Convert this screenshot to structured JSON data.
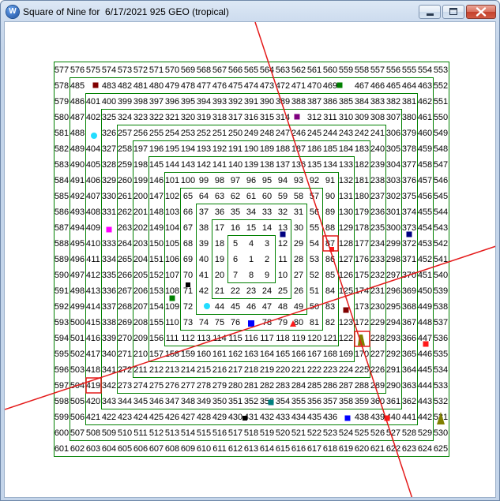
{
  "window": {
    "title": "Square of Nine for  6/17/2021 925 GEO (tropical)",
    "icon_letter": "W",
    "icons": {
      "app": "w-logo-icon",
      "minimize": "minimize-icon",
      "maximize": "maximize-icon",
      "close": "close-icon"
    }
  },
  "colors": {
    "ring_lines": "#008000",
    "angle_line": "#e41a1a",
    "highlight_box": "#e41a1a",
    "marker_maroon": "#800000",
    "marker_green": "#008000",
    "marker_purple": "#800080",
    "marker_cyan": "#22ddff",
    "marker_magenta": "#ff00ff",
    "marker_navy": "#000080",
    "marker_red": "#ff1a1a",
    "marker_black": "#000000",
    "marker_blue": "#0000ff",
    "marker_olive": "#808000",
    "marker_teal": "#008080"
  },
  "square_of_nine": {
    "grid": [
      [
        577,
        576,
        575,
        574,
        573,
        572,
        571,
        570,
        569,
        568,
        567,
        566,
        565,
        564,
        563,
        562,
        561,
        560,
        559,
        558,
        557,
        556,
        555,
        554,
        553
      ],
      [
        578,
        485,
        null,
        483,
        482,
        481,
        480,
        479,
        478,
        477,
        476,
        475,
        474,
        473,
        472,
        471,
        470,
        469,
        null,
        467,
        466,
        465,
        464,
        463,
        552
      ],
      [
        579,
        486,
        401,
        400,
        399,
        398,
        397,
        396,
        395,
        394,
        393,
        392,
        391,
        390,
        389,
        388,
        387,
        386,
        385,
        384,
        383,
        382,
        381,
        462,
        551
      ],
      [
        580,
        487,
        402,
        325,
        324,
        323,
        322,
        321,
        320,
        319,
        318,
        317,
        316,
        315,
        314,
        null,
        312,
        311,
        310,
        309,
        308,
        307,
        380,
        461,
        550
      ],
      [
        581,
        488,
        null,
        326,
        257,
        256,
        255,
        254,
        253,
        252,
        251,
        250,
        249,
        248,
        247,
        246,
        245,
        244,
        243,
        242,
        241,
        306,
        379,
        460,
        549
      ],
      [
        582,
        489,
        404,
        327,
        258,
        197,
        196,
        195,
        194,
        193,
        192,
        191,
        190,
        189,
        188,
        187,
        186,
        185,
        184,
        183,
        240,
        305,
        378,
        459,
        548
      ],
      [
        583,
        490,
        405,
        328,
        259,
        198,
        145,
        144,
        143,
        142,
        141,
        140,
        139,
        138,
        137,
        136,
        135,
        134,
        133,
        182,
        239,
        304,
        377,
        458,
        547
      ],
      [
        584,
        491,
        406,
        329,
        260,
        199,
        146,
        101,
        100,
        99,
        98,
        97,
        96,
        95,
        94,
        93,
        92,
        91,
        132,
        181,
        238,
        303,
        376,
        457,
        546
      ],
      [
        585,
        492,
        407,
        330,
        261,
        200,
        147,
        102,
        65,
        64,
        63,
        62,
        61,
        60,
        59,
        58,
        57,
        90,
        131,
        180,
        237,
        302,
        375,
        456,
        545
      ],
      [
        586,
        493,
        408,
        331,
        262,
        201,
        148,
        103,
        66,
        37,
        36,
        35,
        34,
        33,
        32,
        31,
        56,
        89,
        130,
        179,
        236,
        301,
        374,
        455,
        544
      ],
      [
        587,
        494,
        409,
        null,
        263,
        202,
        149,
        104,
        67,
        38,
        17,
        16,
        15,
        14,
        13,
        30,
        55,
        88,
        129,
        178,
        235,
        300,
        373,
        454,
        543
      ],
      [
        588,
        495,
        410,
        333,
        264,
        203,
        150,
        105,
        68,
        39,
        18,
        5,
        4,
        3,
        12,
        29,
        54,
        87,
        128,
        177,
        234,
        299,
        372,
        453,
        542
      ],
      [
        589,
        496,
        411,
        334,
        265,
        204,
        151,
        106,
        69,
        40,
        19,
        6,
        1,
        2,
        11,
        28,
        53,
        86,
        127,
        176,
        233,
        298,
        371,
        452,
        541
      ],
      [
        590,
        497,
        412,
        335,
        266,
        205,
        152,
        107,
        70,
        41,
        20,
        7,
        8,
        9,
        10,
        27,
        52,
        85,
        126,
        175,
        232,
        297,
        370,
        451,
        540
      ],
      [
        591,
        498,
        413,
        336,
        267,
        206,
        153,
        108,
        71,
        42,
        21,
        22,
        23,
        24,
        25,
        26,
        51,
        84,
        125,
        174,
        231,
        296,
        369,
        450,
        539
      ],
      [
        592,
        499,
        414,
        337,
        268,
        207,
        154,
        109,
        72,
        null,
        44,
        45,
        46,
        47,
        48,
        49,
        50,
        83,
        null,
        173,
        230,
        295,
        368,
        449,
        538
      ],
      [
        593,
        500,
        415,
        338,
        269,
        208,
        155,
        110,
        73,
        74,
        75,
        76,
        null,
        78,
        79,
        80,
        81,
        82,
        123,
        172,
        229,
        294,
        367,
        448,
        537
      ],
      [
        594,
        501,
        416,
        339,
        270,
        209,
        156,
        111,
        112,
        113,
        114,
        115,
        116,
        117,
        118,
        119,
        120,
        121,
        122,
        null,
        228,
        293,
        366,
        447,
        536
      ],
      [
        595,
        502,
        417,
        340,
        271,
        210,
        157,
        158,
        159,
        160,
        161,
        162,
        163,
        164,
        165,
        166,
        167,
        168,
        169,
        170,
        227,
        292,
        365,
        446,
        535
      ],
      [
        596,
        503,
        418,
        341,
        272,
        211,
        212,
        213,
        214,
        215,
        216,
        217,
        218,
        219,
        220,
        221,
        222,
        223,
        224,
        225,
        226,
        291,
        364,
        445,
        534
      ],
      [
        597,
        504,
        419,
        342,
        273,
        274,
        275,
        276,
        277,
        278,
        279,
        280,
        281,
        282,
        283,
        284,
        285,
        286,
        287,
        288,
        289,
        290,
        363,
        444,
        533
      ],
      [
        598,
        505,
        420,
        343,
        344,
        345,
        346,
        347,
        348,
        349,
        350,
        351,
        352,
        353,
        354,
        355,
        356,
        357,
        358,
        359,
        360,
        361,
        362,
        443,
        532
      ],
      [
        599,
        506,
        421,
        422,
        423,
        424,
        425,
        426,
        427,
        428,
        429,
        430,
        431,
        432,
        433,
        434,
        435,
        436,
        null,
        438,
        439,
        440,
        441,
        442,
        531
      ],
      [
        600,
        507,
        508,
        509,
        510,
        511,
        512,
        513,
        514,
        515,
        516,
        517,
        518,
        519,
        520,
        521,
        522,
        523,
        524,
        525,
        526,
        527,
        528,
        529,
        530
      ],
      [
        601,
        602,
        603,
        604,
        605,
        606,
        607,
        608,
        609,
        610,
        611,
        612,
        613,
        614,
        615,
        616,
        617,
        618,
        619,
        620,
        621,
        622,
        623,
        624,
        625
      ]
    ]
  }
}
